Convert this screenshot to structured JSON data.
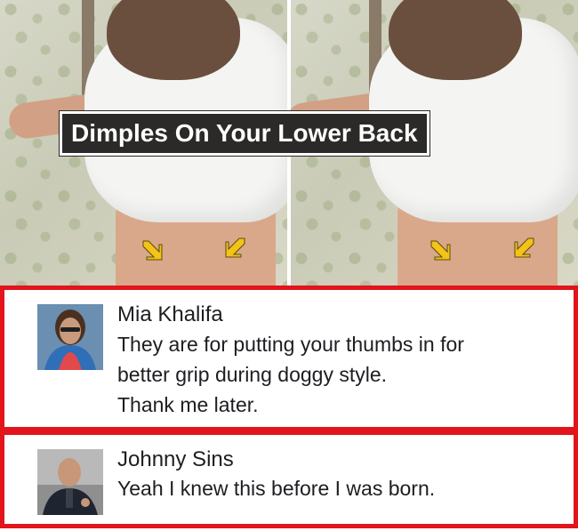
{
  "meme": {
    "caption": "Dimples On Your Lower Back",
    "panels": [
      "photo-left",
      "photo-right"
    ]
  },
  "comments": [
    {
      "author": "Mia Khalifa",
      "text": "They are for putting your thumbs in for\nbetter grip during doggy style.\nThank me later."
    },
    {
      "author": "Johnny Sins",
      "text": "Yeah I knew this before I was born."
    }
  ],
  "colors": {
    "highlight_border": "#e2141c",
    "arrow": "#f3c316",
    "caption_bg": "#2b2a28"
  }
}
